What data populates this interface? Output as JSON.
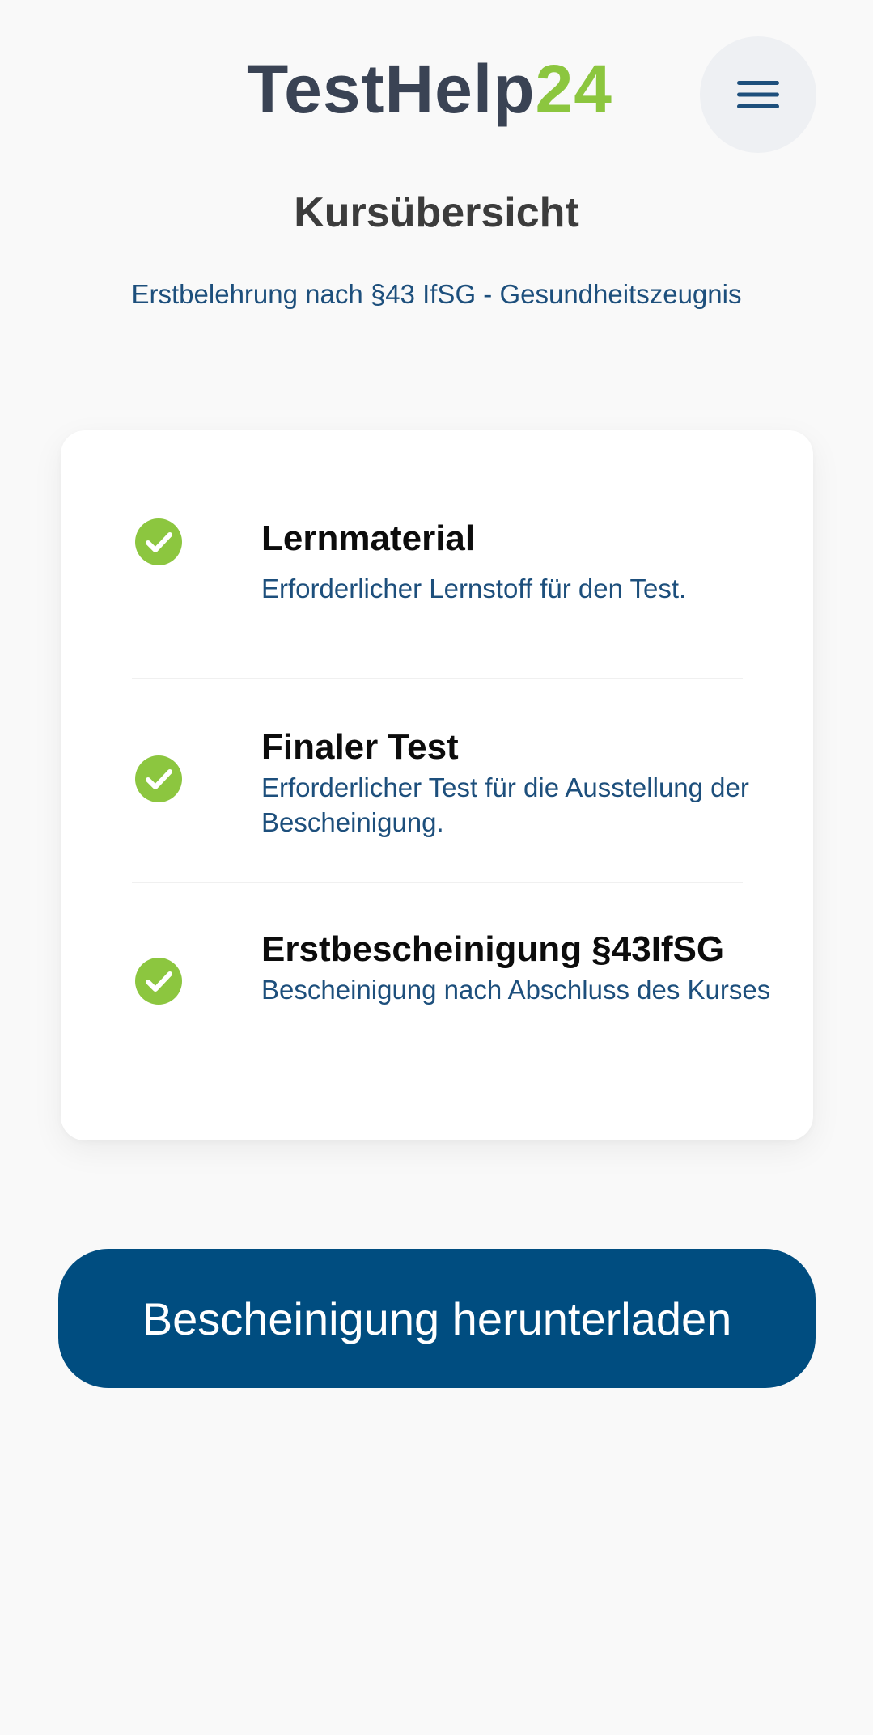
{
  "header": {
    "logo_main": "TestHelp",
    "logo_accent": "24",
    "menu_icon": "hamburger-menu-icon"
  },
  "page": {
    "title": "Kursübersicht",
    "subtitle": "Erstbelehrung nach §43 IfSG - Gesundheitszeugnis"
  },
  "course_items": [
    {
      "title": "Lernmaterial",
      "description": "Erforderlicher Lernstoff für den Test.",
      "status": "completed",
      "icon": "check-circle-icon"
    },
    {
      "title": "Finaler Test",
      "description": "Erforderlicher Test für die Ausstellung der Bescheinigung.",
      "status": "completed",
      "icon": "check-circle-icon"
    },
    {
      "title": "Erstbescheinigung §43IfSG",
      "description": "Bescheinigung nach Abschluss des Kurses",
      "status": "completed",
      "icon": "check-circle-icon"
    }
  ],
  "actions": {
    "download_label": "Bescheinigung herunterladen"
  },
  "colors": {
    "brand_dark": "#3a4354",
    "brand_green": "#8cc63f",
    "primary_blue": "#004d80",
    "link_blue": "#1d4f7c",
    "check_green": "#8cc63f",
    "background": "#f9f9f9"
  }
}
